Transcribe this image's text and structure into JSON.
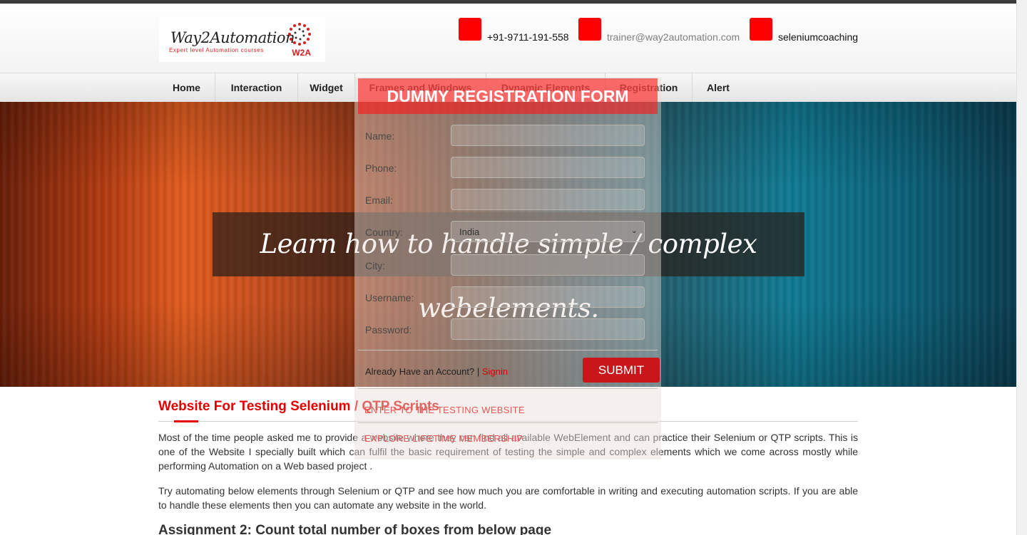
{
  "header": {
    "logo_text": "Way2Automation",
    "logo_tagline": "Expert level Automation courses",
    "logo_badge": "W2A",
    "phone": "+91-9711-191-558",
    "email": "trainer@way2automation.com",
    "skype": "seleniumcoaching"
  },
  "nav": {
    "items": [
      "Home",
      "Interaction",
      "Widget",
      "Frames and Windows",
      "Dynamic Elements",
      "Registration",
      "Alert"
    ]
  },
  "hero": {
    "caption": "Learn how to handle simple / complex webelements."
  },
  "modal": {
    "title": "DUMMY REGISTRATION FORM",
    "fields": [
      {
        "label": "Name:",
        "value": ""
      },
      {
        "label": "Phone:",
        "value": ""
      },
      {
        "label": "Email:",
        "value": ""
      },
      {
        "label": "Country:",
        "value": "India"
      },
      {
        "label": "City:",
        "value": ""
      },
      {
        "label": "Username:",
        "value": ""
      },
      {
        "label": "Password:",
        "value": ""
      }
    ],
    "already_text": "Already Have an Account? |",
    "signin_link": "Signin",
    "submit_label": "SUBMIT",
    "enter_link": "ENTER TO THE TESTING WEBSITE",
    "explore_link": "EXPLORE LIFETIME MEMBERSHIP"
  },
  "content": {
    "heading": "Website For Testing Selenium / QTP Scripts",
    "para1": "Most of the time people asked me to provide a website where they can find all available WebElement and can practice their Selenium or QTP scripts. This is one of the Website I specially built which can fulfil the basic requirement of testing the simple and complex elements which we come across mostly while performing Automation on a Web based project .",
    "para2": "Try automating below elements through Selenium or QTP and see how much you are comfortable in writing and executing automation scripts. If you are able to handle these elements then you can automate any website in the world.",
    "assignment": "Assignment 2: Count total number of boxes from below page"
  },
  "colors": {
    "accent": "#e00000",
    "submit_bg": "#c9161a",
    "icon_red": "#ff0000"
  }
}
